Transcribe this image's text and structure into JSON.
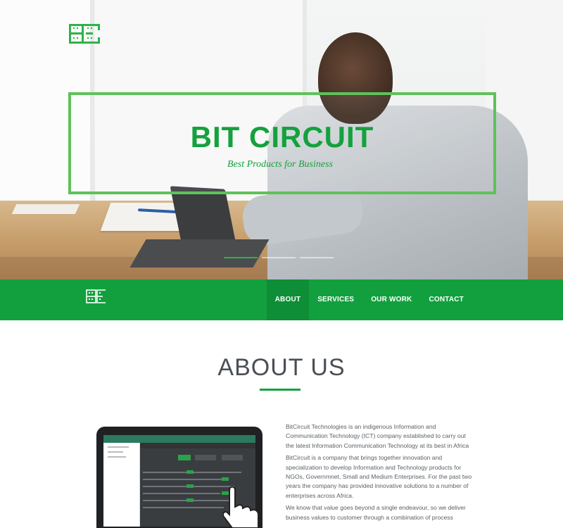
{
  "hero": {
    "title": "BIT CIRCUIT",
    "tagline": "Best Products for Business",
    "logo_icon": "bitcircuit-logo",
    "slider_count": 3,
    "slider_active": 0,
    "accent_color": "#15a13e",
    "frame_color": "#5fc15a"
  },
  "nav": {
    "logo_icon": "bitcircuit-logo",
    "background": "#12a03e",
    "items": [
      {
        "label": "ABOUT",
        "active": true
      },
      {
        "label": "SERVICES",
        "active": false
      },
      {
        "label": "OUR WORK",
        "active": false
      },
      {
        "label": "CONTACT",
        "active": false
      }
    ]
  },
  "about": {
    "title": "ABOUT US",
    "paragraphs": [
      "BitCircuit Technologies is an indigenous Information and Communication Technology (ICT) company established to carry out the latest Information Communication Technology at its best in Africa",
      "BitCircuit is a company that brings together innovation and specialization to develop Information and Technology products for NGOs, Governmnet, Small and Medium Enterprises. For the past two years the company has provided innovative solutions to a number of enterprises across Africa.",
      "We know that value goes beyond a single endeavour, so we deliver business values to customer through a combination of process"
    ],
    "image_icon": "tablet-app-screenshot"
  }
}
